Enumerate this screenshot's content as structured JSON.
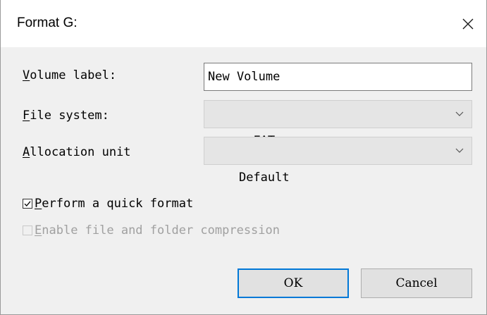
{
  "dialog": {
    "title": "Format G:",
    "close_icon": "close-icon"
  },
  "fields": {
    "volume_label": {
      "accesskey": "V",
      "label_rest": "olume label:",
      "value": "New Volume"
    },
    "file_system": {
      "accesskey": "F",
      "label_rest": "ile system:",
      "selected": "exFAT"
    },
    "allocation_unit": {
      "accesskey": "A",
      "label_rest": "llocation unit",
      "selected": "Default"
    }
  },
  "options": {
    "quick_format": {
      "accesskey": "P",
      "label_rest": "erform a quick format",
      "checked": true
    },
    "compression": {
      "accesskey": "E",
      "label_rest": "nable file and folder compression",
      "checked": false,
      "enabled": false
    }
  },
  "buttons": {
    "ok": "OK",
    "cancel": "Cancel"
  },
  "colors": {
    "default_button_border": "#0078d7",
    "dialog_background": "#f0f0f0"
  }
}
